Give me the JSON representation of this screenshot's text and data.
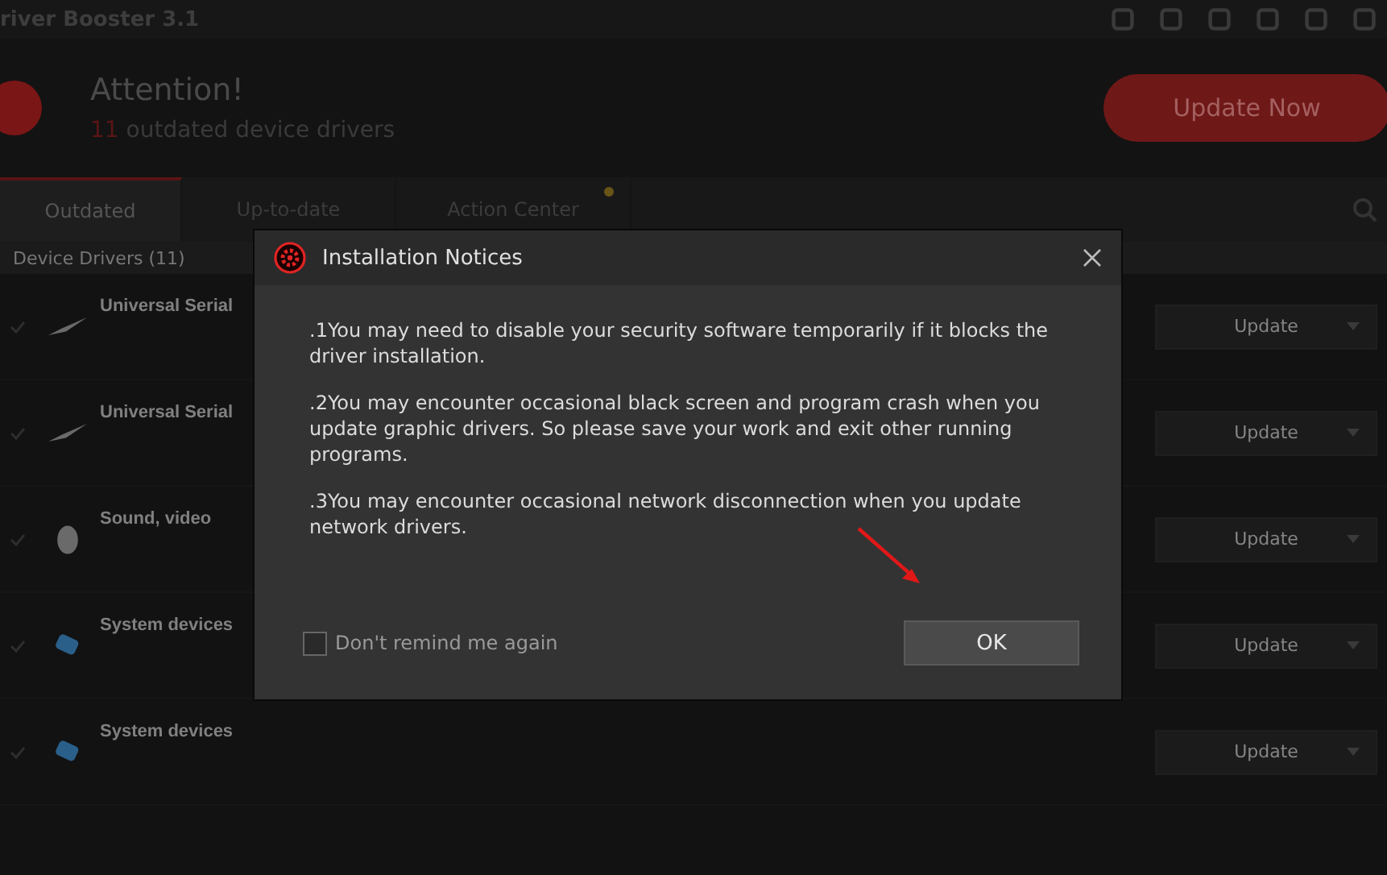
{
  "app": {
    "title": "river Booster 3.1"
  },
  "header": {
    "heading": "Attention!",
    "count": "11",
    "summary": "outdated device drivers",
    "update_button": "Update Now"
  },
  "tabs": [
    {
      "label": "Outdated",
      "selected": true,
      "dot": false
    },
    {
      "label": "Up-to-date",
      "selected": false,
      "dot": false
    },
    {
      "label": "Action Center",
      "selected": false,
      "dot": true
    }
  ],
  "section": {
    "label": "Device Drivers (11)"
  },
  "rows": [
    {
      "kind": "usb",
      "name": "Universal Serial",
      "checked": true,
      "button": "Update"
    },
    {
      "kind": "usb",
      "name": "Universal Serial",
      "checked": true,
      "button": "Update"
    },
    {
      "kind": "sound",
      "name": "Sound, video",
      "checked": true,
      "button": "Update"
    },
    {
      "kind": "system",
      "name": "System devices",
      "checked": true,
      "button": "Update"
    },
    {
      "kind": "system",
      "name": "System devices",
      "checked": true,
      "button": "Update"
    }
  ],
  "dialog": {
    "title": "Installation Notices",
    "notices": [
      ".1You may need to disable your security software temporarily if it blocks the driver installation.",
      ".2You may encounter occasional black screen and program crash when you update graphic drivers. So please save your work and exit other running programs.",
      ".3You may encounter occasional network disconnection when you update network drivers."
    ],
    "remind": {
      "label": "Don't remind me again",
      "checked": false
    },
    "ok_button": "OK"
  }
}
